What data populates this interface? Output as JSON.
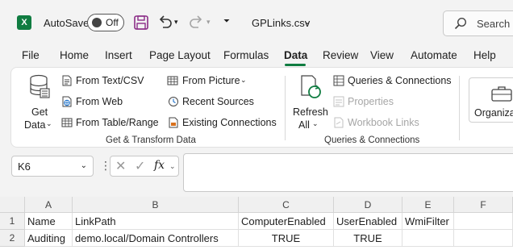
{
  "titlebar": {
    "app_logo": "X",
    "autosave_label": "AutoSave",
    "autosave_state": "Off",
    "filename": "GPLinks.csv",
    "search_placeholder": "Search"
  },
  "tabs": [
    "File",
    "Home",
    "Insert",
    "Page Layout",
    "Formulas",
    "Data",
    "Review",
    "View",
    "Automate",
    "Help"
  ],
  "active_tab": "Data",
  "ribbon": {
    "get_data": {
      "line1": "Get",
      "line2": "Data"
    },
    "from_text_csv": "From Text/CSV",
    "from_web": "From Web",
    "from_table_range": "From Table/Range",
    "from_picture": "From Picture",
    "recent_sources": "Recent Sources",
    "existing_connections": "Existing Connections",
    "group1_label": "Get & Transform Data",
    "refresh_all": {
      "line1": "Refresh",
      "line2": "All"
    },
    "queries_connections": "Queries & Connections",
    "properties": "Properties",
    "workbook_links": "Workbook Links",
    "group2_label": "Queries & Connections",
    "organize": "Organizat"
  },
  "formula_bar": {
    "name_box": "K6",
    "fx": "fx",
    "content": ""
  },
  "grid": {
    "columns": [
      "A",
      "B",
      "C",
      "D",
      "E",
      "F"
    ],
    "rows": [
      {
        "num": "1",
        "cells": [
          "Name",
          "LinkPath",
          "ComputerEnabled",
          "UserEnabled",
          "WmiFilter",
          ""
        ]
      },
      {
        "num": "2",
        "cells": [
          "Auditing",
          "demo.local/Domain Controllers",
          "TRUE",
          "TRUE",
          "",
          ""
        ]
      }
    ]
  }
}
